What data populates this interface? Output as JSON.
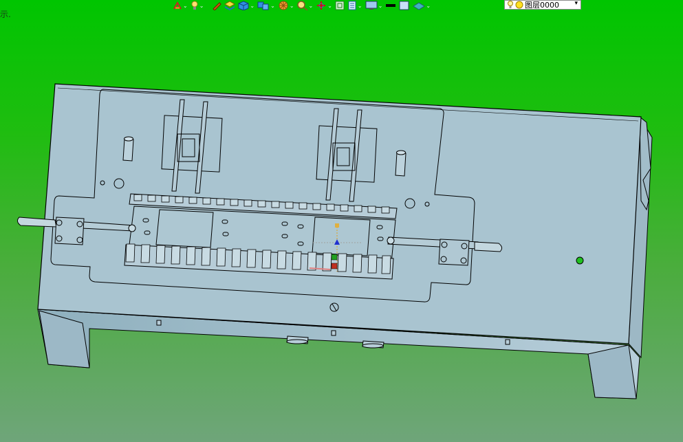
{
  "edge_text": "示.",
  "toolbar": {
    "items": [
      {
        "icon": "wire-icon"
      },
      {
        "icon": "lamp-icon"
      },
      {
        "icon": "pencil-icon"
      },
      {
        "icon": "layers-icon"
      },
      {
        "icon": "cube-icon"
      },
      {
        "icon": "multi-cube-icon"
      },
      {
        "icon": "wheel-icon"
      },
      {
        "icon": "magnifier-icon"
      },
      {
        "icon": "crosshair-icon"
      },
      {
        "icon": "frame-icon"
      },
      {
        "icon": "doc-icon"
      },
      {
        "icon": "monitor-icon"
      },
      {
        "icon": "color-swatch-icon"
      },
      {
        "icon": "background-icon"
      },
      {
        "icon": "plane-icon"
      }
    ]
  },
  "layer": {
    "label": "图层0000"
  },
  "colors": {
    "background_top": "#00c500",
    "background_bottom": "#6fa57a",
    "model_fill": "#a9c4d0",
    "model_edge": "#000000"
  }
}
